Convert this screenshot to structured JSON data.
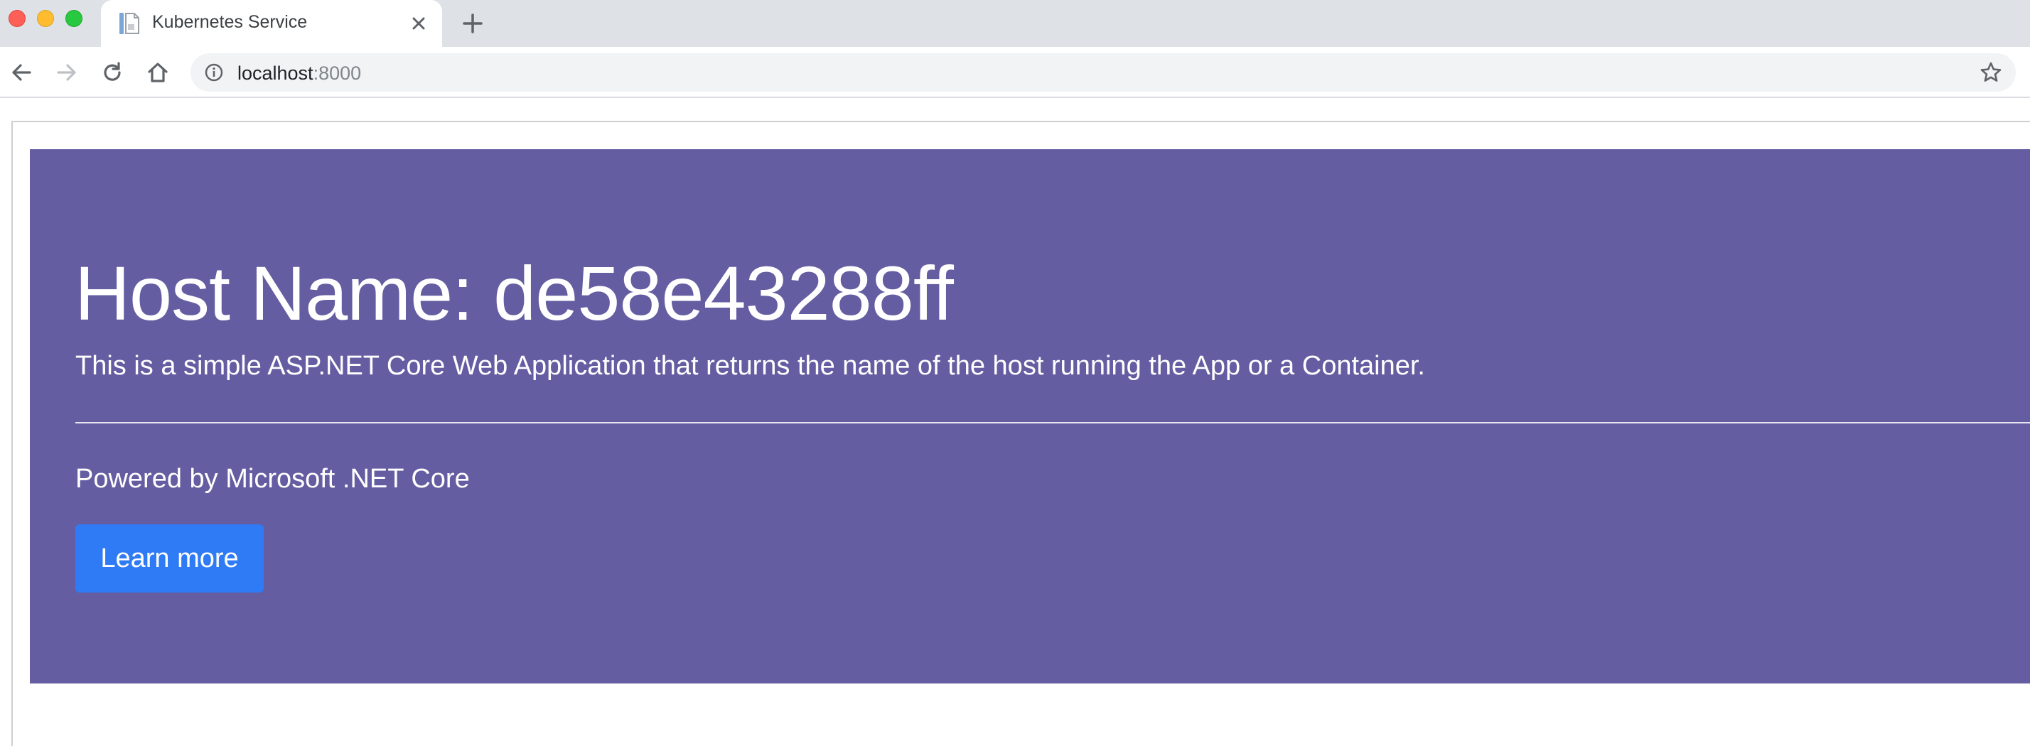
{
  "browser": {
    "tab": {
      "title": "Kubernetes Service",
      "favicon": "document-icon"
    },
    "address_bar": {
      "host": "localhost",
      "port": ":8000"
    },
    "icons": {
      "back": "arrow-left-icon",
      "forward": "arrow-right-icon",
      "reload": "reload-icon",
      "home": "home-icon",
      "site_info": "info-icon",
      "bookmark": "star-icon",
      "close_tab": "close-icon",
      "new_tab": "plus-icon"
    },
    "colors": {
      "tab_strip": "#dee1e6",
      "omnibox": "#f1f3f4"
    }
  },
  "page": {
    "heading": "Host Name: de58e43288ff",
    "lead": "This is a simple ASP.NET Core Web Application that returns the name of the host running the App or a Container.",
    "powered_by": "Powered by Microsoft .NET Core",
    "learn_more_label": "Learn more",
    "colors": {
      "jumbotron": "#645da1",
      "button": "#2f7bf5",
      "text": "#ffffff"
    }
  }
}
